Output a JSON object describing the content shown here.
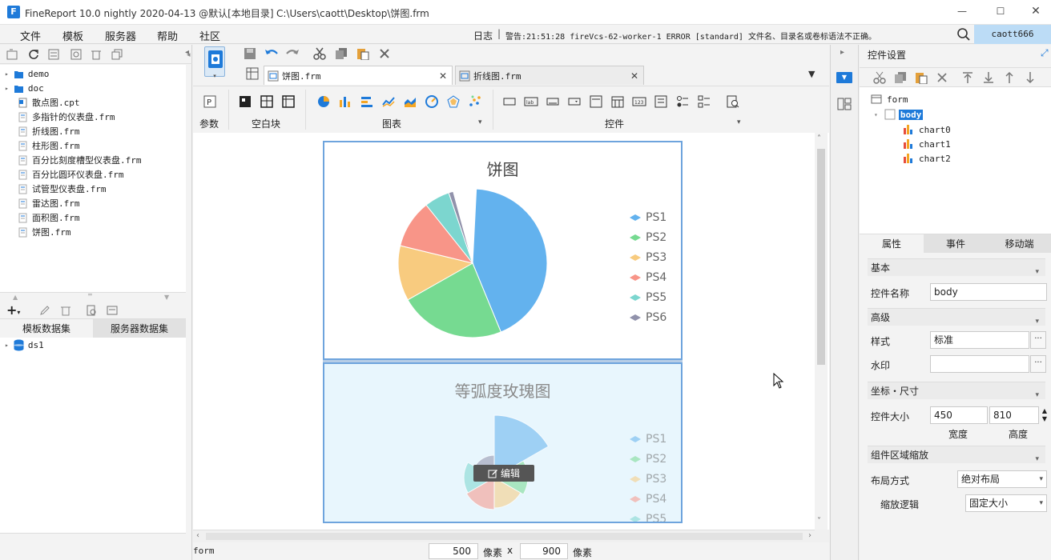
{
  "window": {
    "title": "FineReport 10.0 nightly 2020-04-13 @默认[本地目录]",
    "path": "C:\\Users\\caott\\Desktop\\饼图.frm"
  },
  "menu": [
    "文件",
    "模板",
    "服务器",
    "帮助",
    "社区"
  ],
  "statusbar": {
    "log_label": "日志",
    "warning": "警告:21:51:28 fireVcs-62-worker-1 ERROR [standard] 文件名、目录名或卷标语法不正确。",
    "user": "caott666"
  },
  "file_tree": [
    {
      "name": "demo",
      "type": "folder"
    },
    {
      "name": "doc",
      "type": "folder"
    },
    {
      "name": "散点图.cpt",
      "type": "cpt"
    },
    {
      "name": "多指针的仪表盘.frm",
      "type": "frm"
    },
    {
      "name": "折线图.frm",
      "type": "frm"
    },
    {
      "name": "柱形图.frm",
      "type": "frm"
    },
    {
      "name": "百分比刻度槽型仪表盘.frm",
      "type": "frm"
    },
    {
      "name": "百分比圆环仪表盘.frm",
      "type": "frm"
    },
    {
      "name": "试管型仪表盘.frm",
      "type": "frm"
    },
    {
      "name": "雷达图.frm",
      "type": "frm"
    },
    {
      "name": "面积图.frm",
      "type": "frm"
    },
    {
      "name": "饼图.frm",
      "type": "frm"
    }
  ],
  "dataset_tabs": [
    "模板数据集",
    "服务器数据集"
  ],
  "datasets": [
    "ds1"
  ],
  "doc_tabs": [
    "饼图.frm",
    "折线图.frm"
  ],
  "widget_groups": {
    "param": "参数",
    "blank": "空白块",
    "chart": "图表",
    "control": "控件"
  },
  "charts": {
    "pie_title": "饼图",
    "rose_title": "等弧度玫瑰图",
    "legend": [
      "PS1",
      "PS2",
      "PS3",
      "PS4",
      "PS5",
      "PS6"
    ],
    "legend_colors": [
      "#63b2ee",
      "#76da91",
      "#f8cb7f",
      "#f89588",
      "#7cd6cf",
      "#9192ab"
    ],
    "edit_label": "编辑"
  },
  "bottom": {
    "form_label": "form",
    "width_value": "500",
    "height_value": "900",
    "unit": "像素",
    "x": "x"
  },
  "right_panel": {
    "title": "控件设置",
    "tree": [
      "form",
      "body",
      "chart0",
      "chart1",
      "chart2"
    ],
    "tabs": [
      "属性",
      "事件",
      "移动端"
    ],
    "sections": {
      "basic": "基本",
      "advanced": "高级",
      "coord": "坐标・尺寸",
      "scale": "组件区域缩放"
    },
    "props": {
      "name_label": "控件名称",
      "name_value": "body",
      "style_label": "样式",
      "style_value": "标准",
      "watermark_label": "水印",
      "watermark_value": "",
      "size_label": "控件大小",
      "width_value": "450",
      "height_value": "810",
      "width_label": "宽度",
      "height_label": "高度",
      "layout_label": "布局方式",
      "layout_value": "绝对布局",
      "scale_label": "缩放逻辑",
      "scale_value": "固定大小"
    }
  }
}
